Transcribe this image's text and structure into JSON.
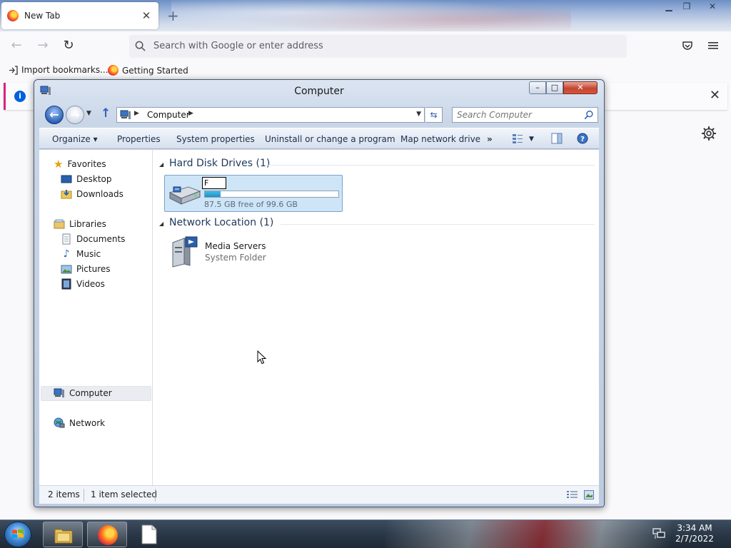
{
  "browser": {
    "tab_title": "New Tab",
    "search_placeholder": "Search with Google or enter address",
    "bookmarks": [
      "Import bookmarks...",
      "Getting Started"
    ],
    "accent": "#0060df"
  },
  "explorer": {
    "title": "Computer",
    "breadcrumb": "Computer",
    "search_placeholder": "Search Computer",
    "toolbar": {
      "organize": "Organize",
      "properties": "Properties",
      "system_properties": "System properties",
      "uninstall": "Uninstall or change a program",
      "map_drive": "Map network drive",
      "more": "»"
    },
    "nav": {
      "favorites": "Favorites",
      "desktop": "Desktop",
      "downloads": "Downloads",
      "libraries": "Libraries",
      "documents": "Documents",
      "music": "Music",
      "pictures": "Pictures",
      "videos": "Videos",
      "computer": "Computer",
      "network": "Network"
    },
    "groups": {
      "hard_disk": "Hard Disk Drives (1)",
      "network_location": "Network Location (1)"
    },
    "drive": {
      "rename_value": "F",
      "free_text": "87.5 GB free of 99.6 GB",
      "used_fraction": 0.12
    },
    "media_server": {
      "name": "Media Servers",
      "type": "System Folder"
    },
    "status": {
      "items": "2 items",
      "selected": "1 item selected"
    }
  },
  "taskbar": {
    "time": "3:34 AM",
    "date": "2/7/2022"
  }
}
